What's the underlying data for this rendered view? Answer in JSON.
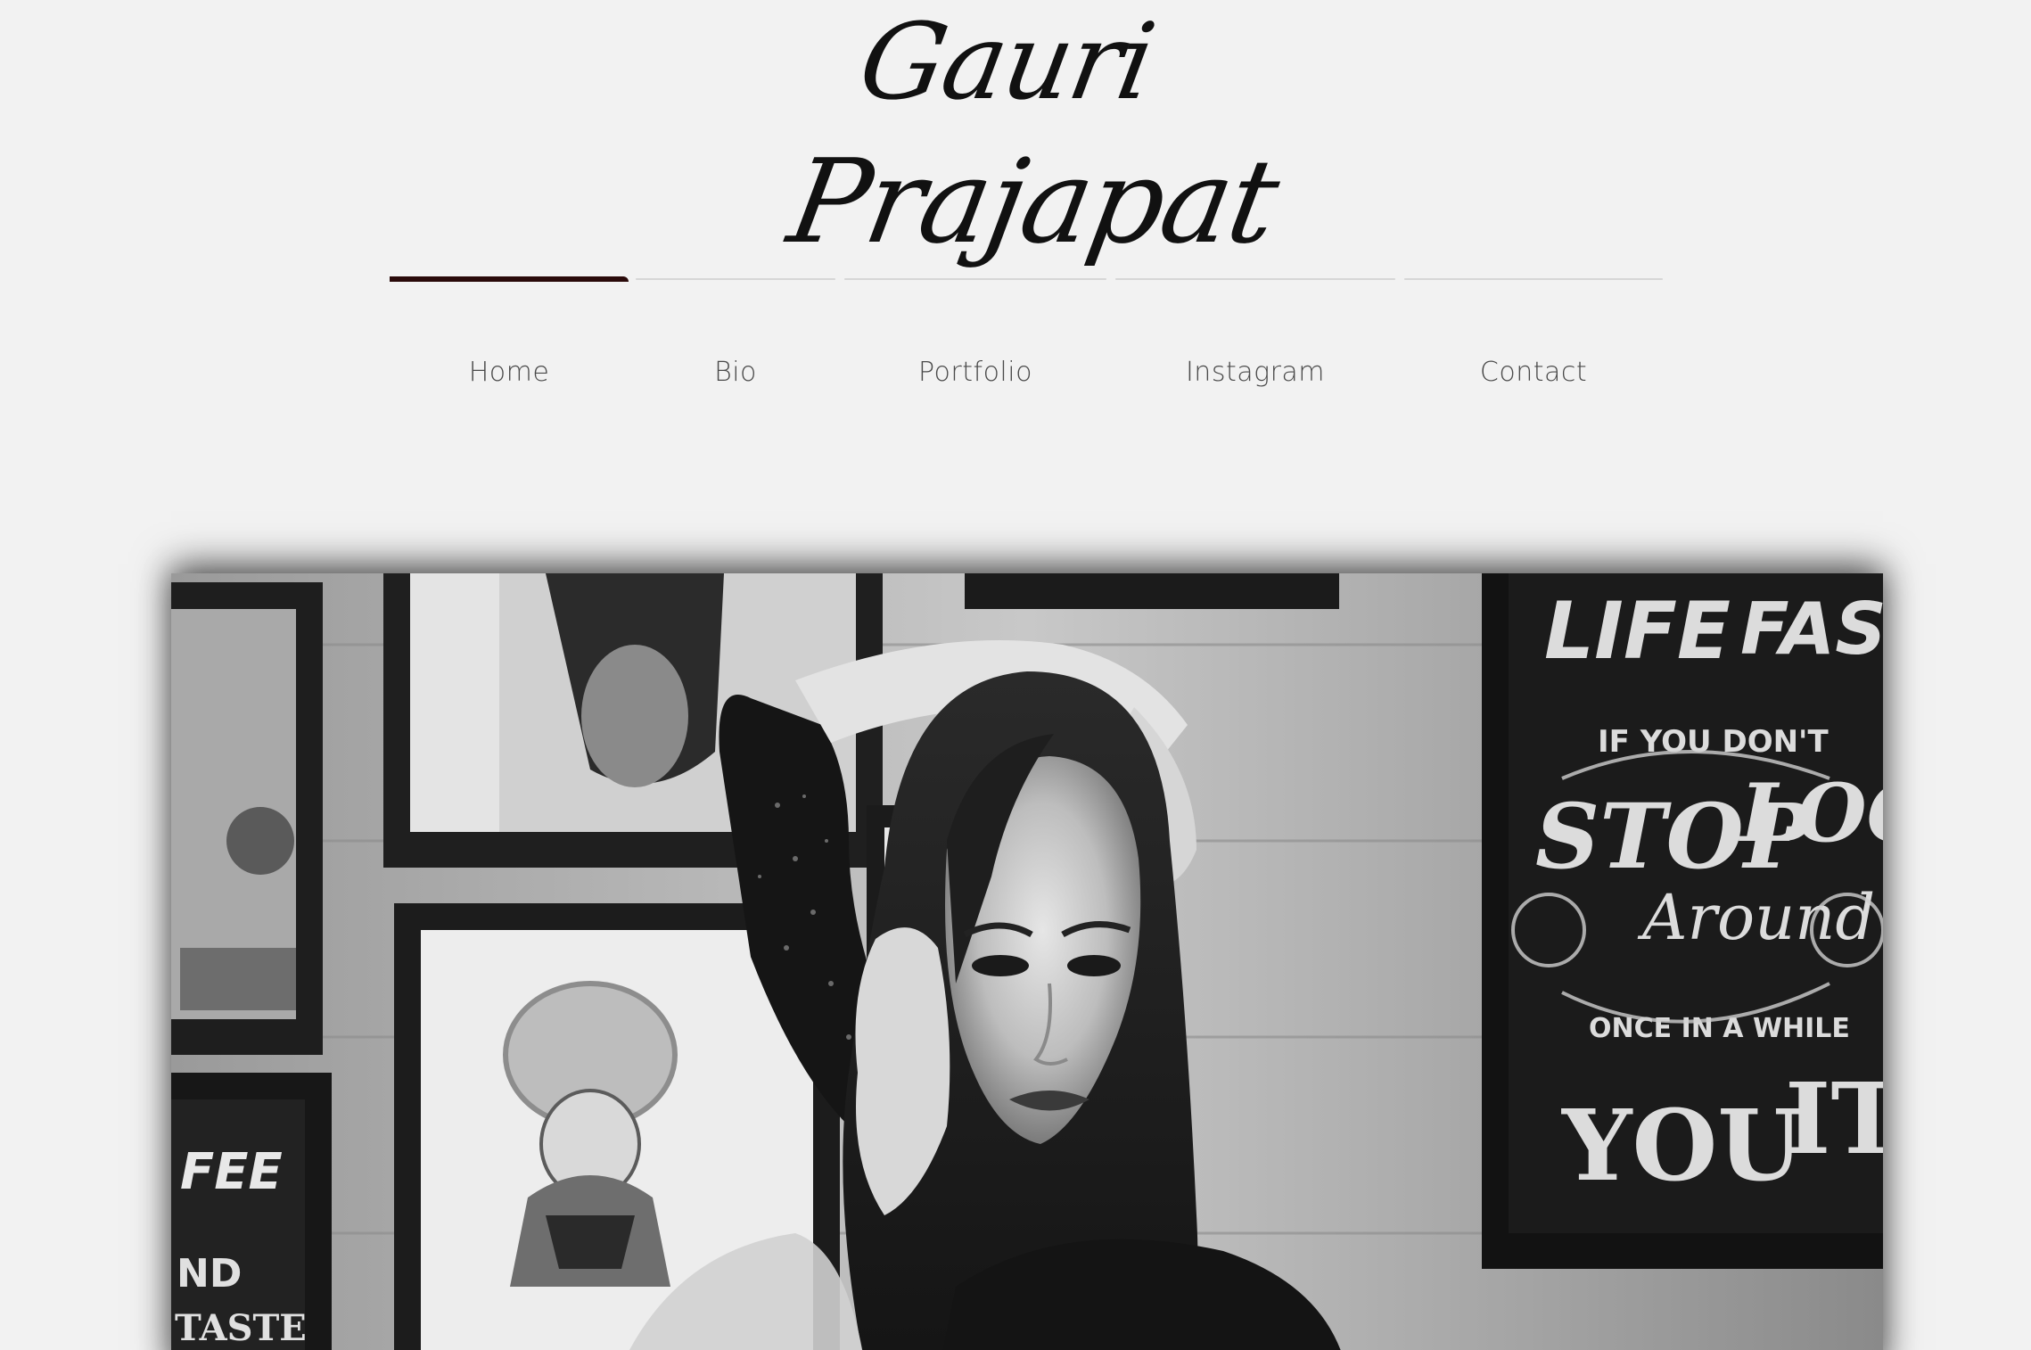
{
  "site": {
    "title_first": "Gauri",
    "title_second": "Prajapat"
  },
  "nav": {
    "items": [
      {
        "label": "Home",
        "active": true
      },
      {
        "label": "Bio",
        "active": false
      },
      {
        "label": "Portfolio",
        "active": false
      },
      {
        "label": "Instagram",
        "active": false
      },
      {
        "label": "Contact",
        "active": false
      }
    ]
  },
  "hero": {
    "poster_lines": [
      "LIFE",
      "FAST",
      "IF YOU DON'T",
      "STOP",
      "LOOK",
      "Around",
      "ONCE IN A WHILE",
      "YOU",
      "IT"
    ],
    "small_poster_lines": [
      "FEE",
      "ND",
      "TASTE"
    ]
  },
  "colors": {
    "background": "#f2f2f2",
    "active_tab": "#2a0a0a",
    "nav_text": "#4a4a4a"
  }
}
